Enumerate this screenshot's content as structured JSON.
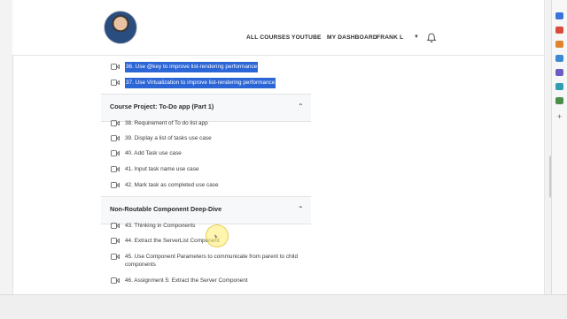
{
  "header": {
    "nav": {
      "all_courses": "ALL COURSES",
      "youtube": "YOUTUBE",
      "dashboard": "MY DASHBOARD",
      "user": "FRANK L"
    }
  },
  "items_top": [
    {
      "label": "36. Use @key to improve list-rendering performance",
      "highlighted": true
    },
    {
      "label": "37. Use Virtualization to improve list-rendering performance",
      "highlighted": true
    }
  ],
  "sections": [
    {
      "title": "Course Project: To-Do app (Part 1)",
      "items": [
        "38. Requirement of To do list app",
        "39. Display a list of tasks use case",
        "40. Add Task use case",
        "41. Input task name use case",
        "42. Mark task as completed use case"
      ]
    },
    {
      "title": "Non-Routable Component Deep-Dive",
      "items": [
        "43. Thinking in Components",
        "44. Extract the ServerList Component",
        "45. Use Component Parameters to communicate from parent to child components",
        "46. Assignment 5: Extract the Server Component"
      ]
    }
  ],
  "colors": {
    "highlight": "#2c65d6",
    "section_bg": "#f7f8fa"
  },
  "icons": [
    "video-icon",
    "chevron-up-icon",
    "bell-icon",
    "caret-down-icon"
  ]
}
